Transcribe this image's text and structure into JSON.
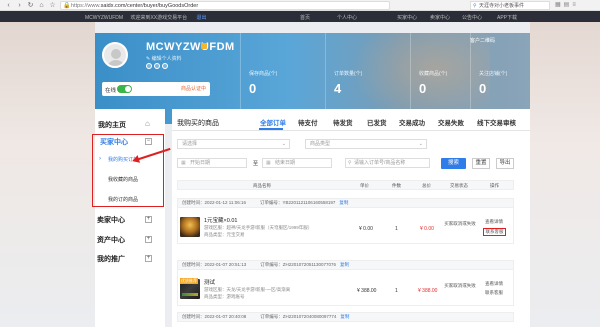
{
  "browser": {
    "url_domain": "https://www.",
    "url_rest": "saidx.com/center/buyer/buyGoodsOrder",
    "search_text": "天涯寺对小老板事件"
  },
  "site_bar": {
    "user": "MCWYZWUFDM",
    "welcome": "欢迎来到XX游戏交易平台",
    "logout": "退出",
    "nav": [
      "首页",
      "个人中心",
      "买家中心",
      "卖家中心",
      "公告中心",
      "APP下载"
    ]
  },
  "profile": {
    "username": "MCWYZWUFDM",
    "edit_label": "编辑个人资料",
    "online_label": "在线",
    "cert_label": "商品认证中",
    "help": "客户二维码",
    "stats": [
      {
        "label": "保存商品(个)",
        "value": "0"
      },
      {
        "label": "订单数量(个)",
        "value": "4"
      },
      {
        "label": "收藏商品(个)",
        "value": "0"
      },
      {
        "label": "关注店铺(个)",
        "value": "0"
      }
    ]
  },
  "sidebar": {
    "home": "我的主页",
    "buyer_center": "买家中心",
    "buyer_items": [
      "我的购买订单",
      "我收藏的商品",
      "我的订的商品"
    ],
    "sections": [
      "卖家中心",
      "资产中心",
      "我的推广"
    ]
  },
  "main": {
    "title": "我购买的商品",
    "tabs": [
      "全部订单",
      "待支付",
      "待发货",
      "已发货",
      "交易成功",
      "交易失败",
      "线下交易审核"
    ]
  },
  "filters": {
    "game_placeholder": "请选择",
    "type_placeholder": "商品类型",
    "start_placeholder": "开始日期",
    "to_label": "至",
    "end_placeholder": "结束日期",
    "keyword_placeholder": "请输入订单号/商品名称",
    "search_label": "搜索",
    "reset_label": "重置",
    "export_label": "导出"
  },
  "table": {
    "headers": [
      "商品名称",
      "单价",
      "件数",
      "总价",
      "交易状态",
      "操作"
    ]
  },
  "orders": [
    {
      "created": "创建时间：2022-01-12 11:06:16",
      "order_no": "订单编号：YB2201121106160558197",
      "copy": "复制",
      "title": "1元宝藏×0.01",
      "meta1": "游戏区服：超神/天龙手游/新服（天穹服区/1999年服）",
      "meta2": "商品类型：元宝交易",
      "price": "¥ 0.00",
      "qty": "1",
      "total": "¥ 0.00",
      "status": "买家取消或失败",
      "actions": [
        "查看详情",
        "联系客服"
      ]
    },
    {
      "created": "创建时间：2022-01-07 20:51:13",
      "order_no": "订单编号：ZH2201072051130077076",
      "copy": "复制",
      "tag": "优质推荐",
      "title": "测试",
      "meta1": "游戏区服：天龙/天龙手游/新服-一区/高渐离",
      "meta2": "商品类型：游戏账号",
      "price": "¥ 388.00",
      "qty": "1",
      "total": "¥ 388.00",
      "status": "买家取消或失败",
      "actions": [
        "查看详情",
        "联系客服"
      ]
    },
    {
      "created": "创建时间：2022-01-07 20:40:08",
      "order_no": "订单编号：ZH2201072040080097774",
      "copy": "复制"
    }
  ]
}
